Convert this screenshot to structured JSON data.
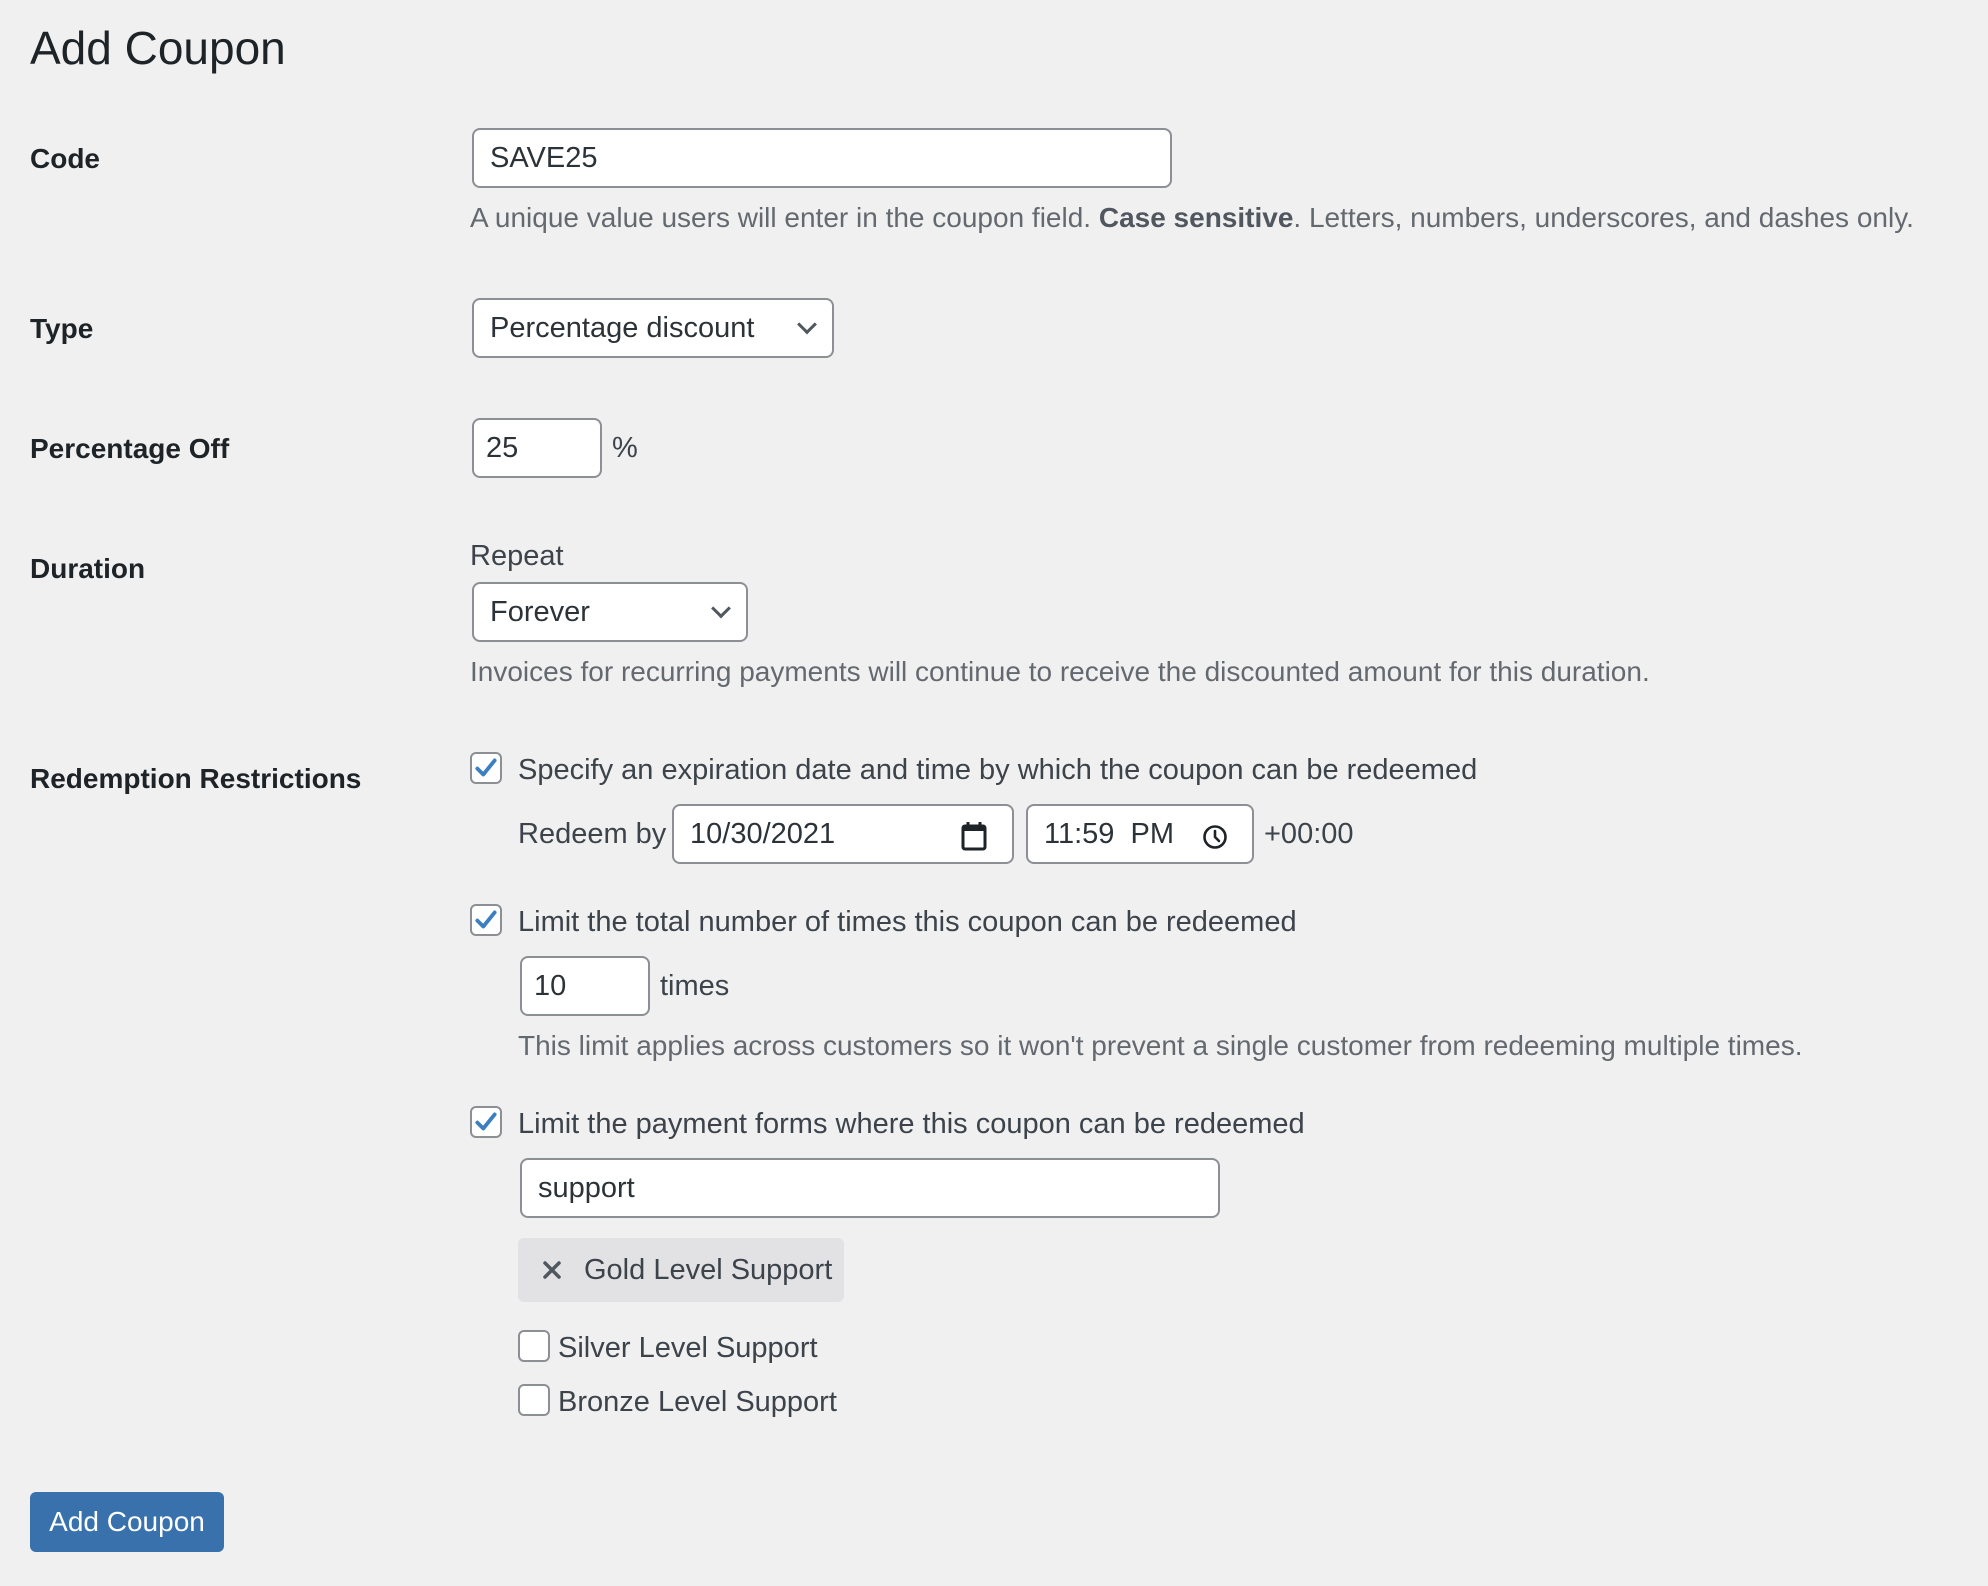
{
  "page": {
    "title": "Add Coupon"
  },
  "code": {
    "label": "Code",
    "value": "SAVE25",
    "desc_before": "A unique value users will enter in the coupon field. ",
    "desc_bold": "Case sensitive",
    "desc_after": ". Letters, numbers, underscores, and dashes only."
  },
  "type": {
    "label": "Type",
    "selected": "Percentage discount"
  },
  "percentage_off": {
    "label": "Percentage Off",
    "value": "25",
    "unit": "%"
  },
  "duration": {
    "label": "Duration",
    "repeat_label": "Repeat",
    "selected": "Forever",
    "desc": "Invoices for recurring payments will continue to receive the discounted amount for this duration."
  },
  "restrictions": {
    "label": "Redemption Restrictions",
    "expiration": {
      "checked": true,
      "label": "Specify an expiration date and time by which the coupon can be redeemed",
      "redeem_by_label": "Redeem by",
      "date": "10/30/2021",
      "time": "11:59  PM",
      "timezone": "+00:00"
    },
    "max_redemptions": {
      "checked": true,
      "label": "Limit the total number of times this coupon can be redeemed",
      "value": "10",
      "unit": "times",
      "desc": "This limit applies across customers so it won't prevent a single customer from redeeming multiple times."
    },
    "forms": {
      "checked": true,
      "label": "Limit the payment forms where this coupon can be redeemed",
      "search_value": "support",
      "selected_chips": [
        {
          "label": "Gold Level Support"
        }
      ],
      "options": [
        {
          "label": "Silver Level Support",
          "checked": false
        },
        {
          "label": "Bronze Level Support",
          "checked": false
        }
      ]
    }
  },
  "submit": {
    "label": "Add Coupon"
  },
  "colors": {
    "primary": "#3871ac",
    "check": "#3c7fc0",
    "background": "#f0f0f1"
  }
}
